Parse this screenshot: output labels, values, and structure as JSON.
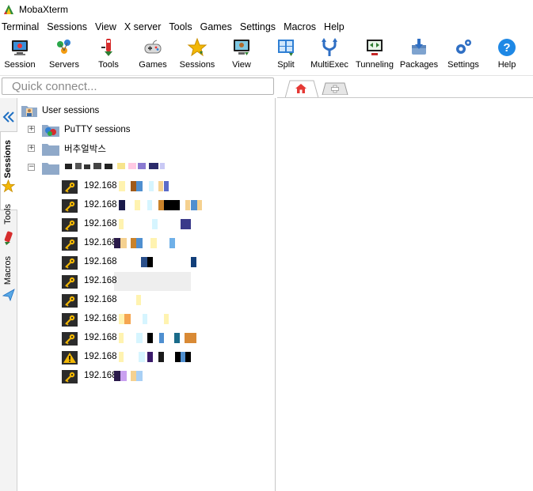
{
  "window": {
    "title": "MobaXterm"
  },
  "menu": [
    "Terminal",
    "Sessions",
    "View",
    "X server",
    "Tools",
    "Games",
    "Settings",
    "Macros",
    "Help"
  ],
  "toolbar": [
    {
      "label": "Session",
      "icon": "session-icon"
    },
    {
      "label": "Servers",
      "icon": "servers-icon"
    },
    {
      "label": "Tools",
      "icon": "tools-icon"
    },
    {
      "label": "Games",
      "icon": "games-icon"
    },
    {
      "label": "Sessions",
      "icon": "sessions-star-icon"
    },
    {
      "label": "View",
      "icon": "view-icon"
    },
    {
      "label": "Split",
      "icon": "split-icon"
    },
    {
      "label": "MultiExec",
      "icon": "multiexec-icon"
    },
    {
      "label": "Tunneling",
      "icon": "tunneling-icon"
    },
    {
      "label": "Packages",
      "icon": "packages-icon"
    },
    {
      "label": "Settings",
      "icon": "settings-icon"
    },
    {
      "label": "Help",
      "icon": "help-icon"
    }
  ],
  "quick_connect": {
    "placeholder": "Quick connect..."
  },
  "side_tabs": {
    "sessions": "Sessions",
    "tools": "Tools",
    "macros": "Macros"
  },
  "tree": {
    "root": "User sessions",
    "groups": [
      {
        "label": "PuTTY sessions",
        "expanded": false
      },
      {
        "label": "버추얼박스",
        "expanded": false
      }
    ],
    "sessions": [
      "192.168",
      "192.168",
      "192.168",
      "192.168",
      "192.168",
      "192.168",
      "192.168",
      "192.168",
      "192.168",
      "192.168",
      "192.168"
    ]
  },
  "colors": {
    "accent": "#2f7fd4",
    "star": "#f2b705",
    "key_bg": "#2b2b2b",
    "key": "#f2b705"
  }
}
